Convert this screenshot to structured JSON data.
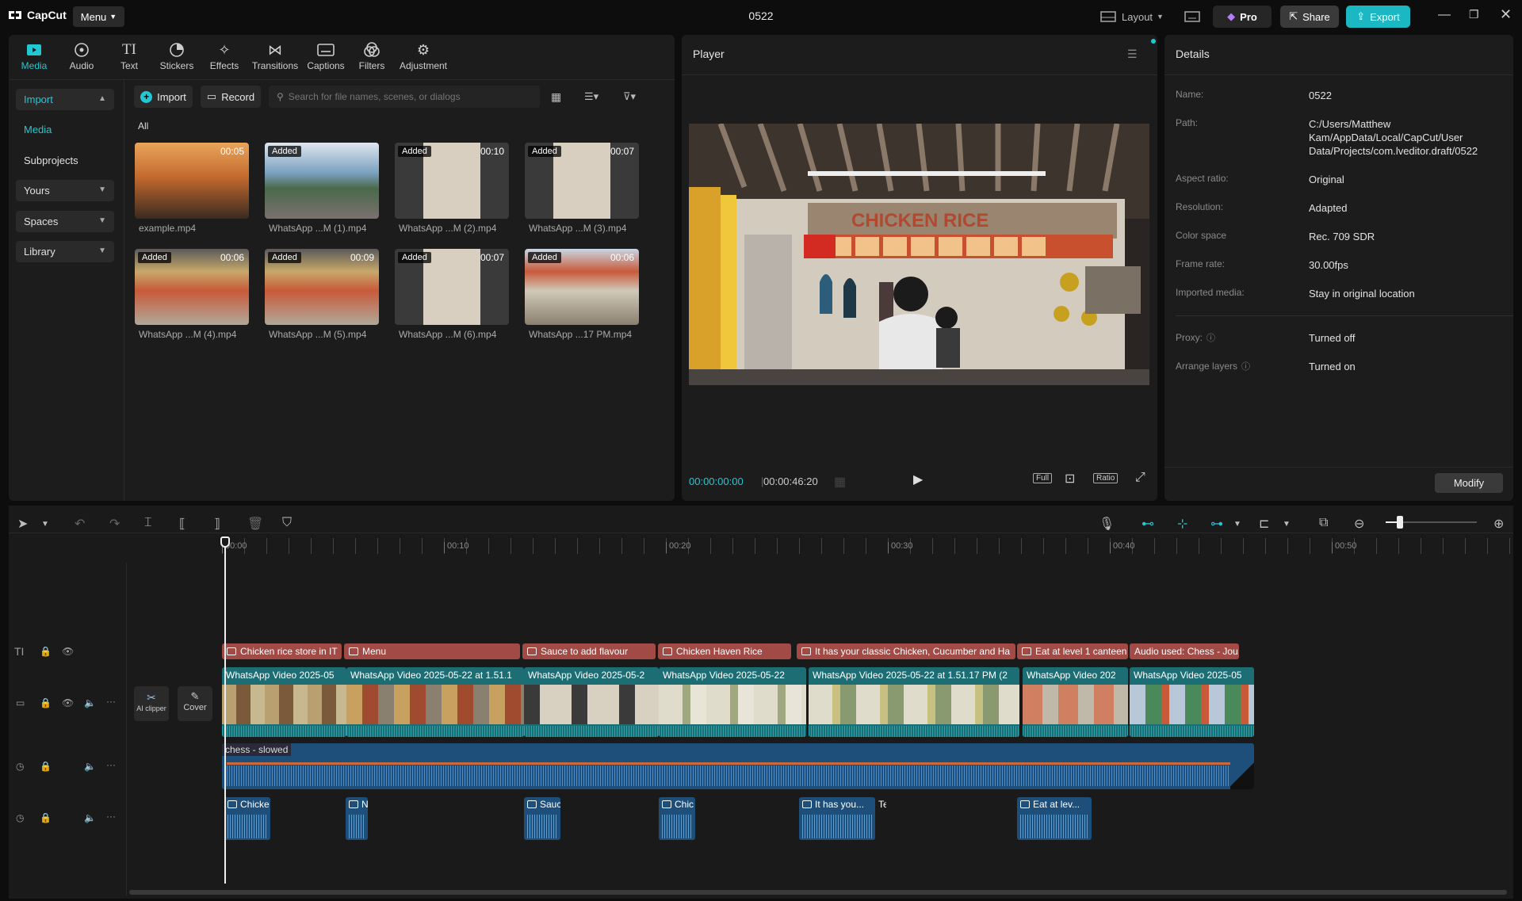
{
  "app": {
    "name": "CapCut",
    "menu_label": "Menu",
    "project_title": "0522"
  },
  "titlebar": {
    "layout_label": "Layout",
    "pro_label": "Pro",
    "share_label": "Share",
    "export_label": "Export"
  },
  "colors": {
    "accent": "#21c8d4",
    "text_clip": "#a24a45",
    "video_clip": "#1d6e74",
    "audio_clip": "#1e4e7a",
    "bg": "#0d0d0d",
    "panel": "#1c1c1c"
  },
  "toolbar_tabs": [
    {
      "label": "Media",
      "icon": "media-icon",
      "active": true
    },
    {
      "label": "Audio",
      "icon": "audio-icon"
    },
    {
      "label": "Text",
      "icon": "text-icon"
    },
    {
      "label": "Stickers",
      "icon": "stickers-icon"
    },
    {
      "label": "Effects",
      "icon": "effects-icon"
    },
    {
      "label": "Transitions",
      "icon": "transitions-icon"
    },
    {
      "label": "Captions",
      "icon": "captions-icon"
    },
    {
      "label": "Filters",
      "icon": "filters-icon"
    },
    {
      "label": "Adjustment",
      "icon": "adjustment-icon"
    }
  ],
  "sidebar": {
    "items": [
      {
        "label": "Import"
      },
      {
        "label": "Media"
      },
      {
        "label": "Subprojects"
      },
      {
        "label": "Yours"
      },
      {
        "label": "Spaces"
      },
      {
        "label": "Library"
      }
    ]
  },
  "media": {
    "import_label": "Import",
    "record_label": "Record",
    "search_placeholder": "Search for file names, scenes, or dialogs",
    "filter_all": "All",
    "items": [
      {
        "name": "example.mp4",
        "badge": "",
        "duration": "00:05"
      },
      {
        "name": "WhatsApp ...M (1).mp4",
        "badge": "Added",
        "duration": ""
      },
      {
        "name": "WhatsApp ...M (2).mp4",
        "badge": "Added",
        "duration": "00:10"
      },
      {
        "name": "WhatsApp ...M (3).mp4",
        "badge": "Added",
        "duration": "00:07"
      },
      {
        "name": "WhatsApp ...M (4).mp4",
        "badge": "Added",
        "duration": "00:06"
      },
      {
        "name": "WhatsApp ...M (5).mp4",
        "badge": "Added",
        "duration": "00:09"
      },
      {
        "name": "WhatsApp ...M (6).mp4",
        "badge": "Added",
        "duration": "00:07"
      },
      {
        "name": "WhatsApp ...17 PM.mp4",
        "badge": "Added",
        "duration": "00:06"
      }
    ]
  },
  "player": {
    "title": "Player",
    "current_time": "00:00:00:00",
    "total_time": "00:00:46:20",
    "full_label": "Full",
    "ratio_label": "Ratio",
    "sign_text": "CHICKEN RICE"
  },
  "details": {
    "title": "Details",
    "rows": [
      {
        "key": "Name:",
        "value": "0522"
      },
      {
        "key": "Path:",
        "value": "C:/Users/Matthew Kam/AppData/Local/CapCut/User Data/Projects/com.lveditor.draft/0522"
      },
      {
        "key": "Aspect ratio:",
        "value": "Original"
      },
      {
        "key": "Resolution:",
        "value": "Adapted"
      },
      {
        "key": "Color space",
        "value": "Rec. 709 SDR"
      },
      {
        "key": "Frame rate:",
        "value": "30.00fps"
      },
      {
        "key": "Imported media:",
        "value": "Stay in original location"
      },
      {
        "key": "Proxy:",
        "value": "Turned off"
      },
      {
        "key": "Arrange layers",
        "value": "Turned on"
      }
    ],
    "modify_label": "Modify"
  },
  "timeline": {
    "ruler": [
      "00:00",
      "00:10",
      "00:20",
      "00:30",
      "00:40",
      "00:50"
    ],
    "ai_clipper_label": "AI clipper",
    "cover_label": "Cover",
    "text_clips": [
      "Chicken rice store in IT",
      "Menu",
      "Sauce to add flavour",
      "Chicken Haven Rice",
      "It has your classic Chicken, Cucumber and Ha",
      "Eat at level 1 canteen",
      "Audio used: Chess - Jou"
    ],
    "video_clips": [
      "WhatsApp Video 2025-05",
      "WhatsApp Video 2025-05-22 at 1.51.1",
      "WhatsApp Video 2025-05-2",
      "WhatsApp Video 2025-05-22",
      "WhatsApp Video 2025-05-22 at 1.51.17 PM (2",
      "WhatsApp Video 202",
      "WhatsApp Video 2025-05"
    ],
    "audio_clip": "chess - slowed",
    "tts_clips": [
      "Chicke",
      "N",
      "Sauc",
      "Chic",
      "It has you...",
      "Te",
      "Eat at lev..."
    ]
  }
}
